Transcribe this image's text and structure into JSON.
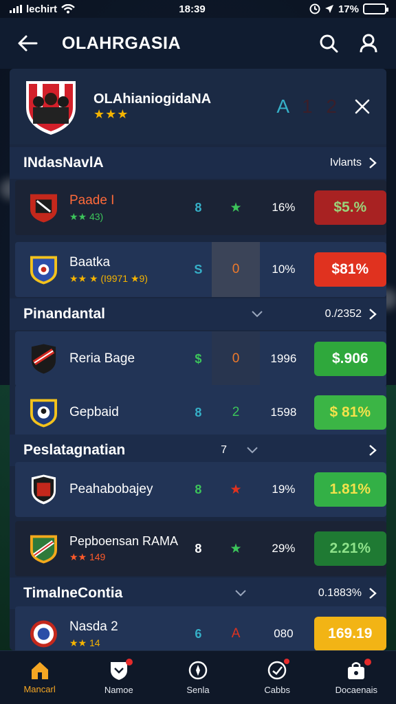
{
  "status_bar": {
    "carrier": "lechirt",
    "time": "18:39",
    "battery": "17%"
  },
  "app_bar": {
    "title": "OLAHRGASIA"
  },
  "team": {
    "name": "OLAhianiogidaNA",
    "stars": "★★★",
    "score_a": "A",
    "score_b": "1 2"
  },
  "sections": [
    {
      "title": "INdasNavlA",
      "right": "Ivlants"
    },
    {
      "title": "Pinandantal",
      "right": "0./2352"
    },
    {
      "title": "Peslatagnatian",
      "mid": "7"
    },
    {
      "title": "TimalneContia",
      "right": "0.1883%"
    }
  ],
  "rows": [
    {
      "name": "Paade I",
      "sub": "★★ 43)",
      "c1": "8",
      "c2": "★",
      "c3": "16%",
      "odds": "$5.%",
      "odds_color": "#a82222",
      "odds_text_color": "#9ad47a"
    },
    {
      "name": "Baatka",
      "sub": "★★ ★ (I9971 ★9)",
      "c1": "S",
      "c2": "0",
      "c3": "10%",
      "odds": "$81%",
      "odds_color": "#e0321f",
      "odds_text_color": "#ffffff"
    },
    {
      "name": "Reria Bage",
      "sub": "",
      "c1": "$",
      "c2": "0",
      "c3": "1996",
      "odds": "$.906",
      "odds_color": "#2fa83c",
      "odds_text_color": "#ffffff"
    },
    {
      "name": "Gepbaid",
      "sub": "",
      "c1": "8",
      "c2": "2",
      "c3": "1598",
      "odds": "$ 81%",
      "odds_color": "#3bb545",
      "odds_text_color": "#f3e24b"
    },
    {
      "name": "Peahabobajey",
      "sub": "",
      "c1": "8",
      "c2": "★",
      "c3": "19%",
      "odds": "1.81%",
      "odds_color": "#33b046",
      "odds_text_color": "#f3e24b"
    },
    {
      "name": "Pepboensan RAMA",
      "sub": "★★ 149",
      "c1": "8",
      "c2": "★",
      "c3": "29%",
      "odds": "2.21%",
      "odds_color": "#1f7a33",
      "odds_text_color": "#8ee28a"
    },
    {
      "name": "Nasda 2",
      "sub": "★★ 14",
      "c1": "6",
      "c2": "A",
      "c3": "080",
      "odds": "169.19",
      "odds_color": "#f2b415",
      "odds_text_color": "#ffffff"
    }
  ],
  "nav": [
    {
      "label": "Mancarl",
      "icon": "home-icon"
    },
    {
      "label": "Namoe",
      "icon": "shield-icon"
    },
    {
      "label": "Senla",
      "icon": "compass-icon"
    },
    {
      "label": "Cabbs",
      "icon": "ball-icon"
    },
    {
      "label": "Docaenais",
      "icon": "bag-icon"
    }
  ]
}
